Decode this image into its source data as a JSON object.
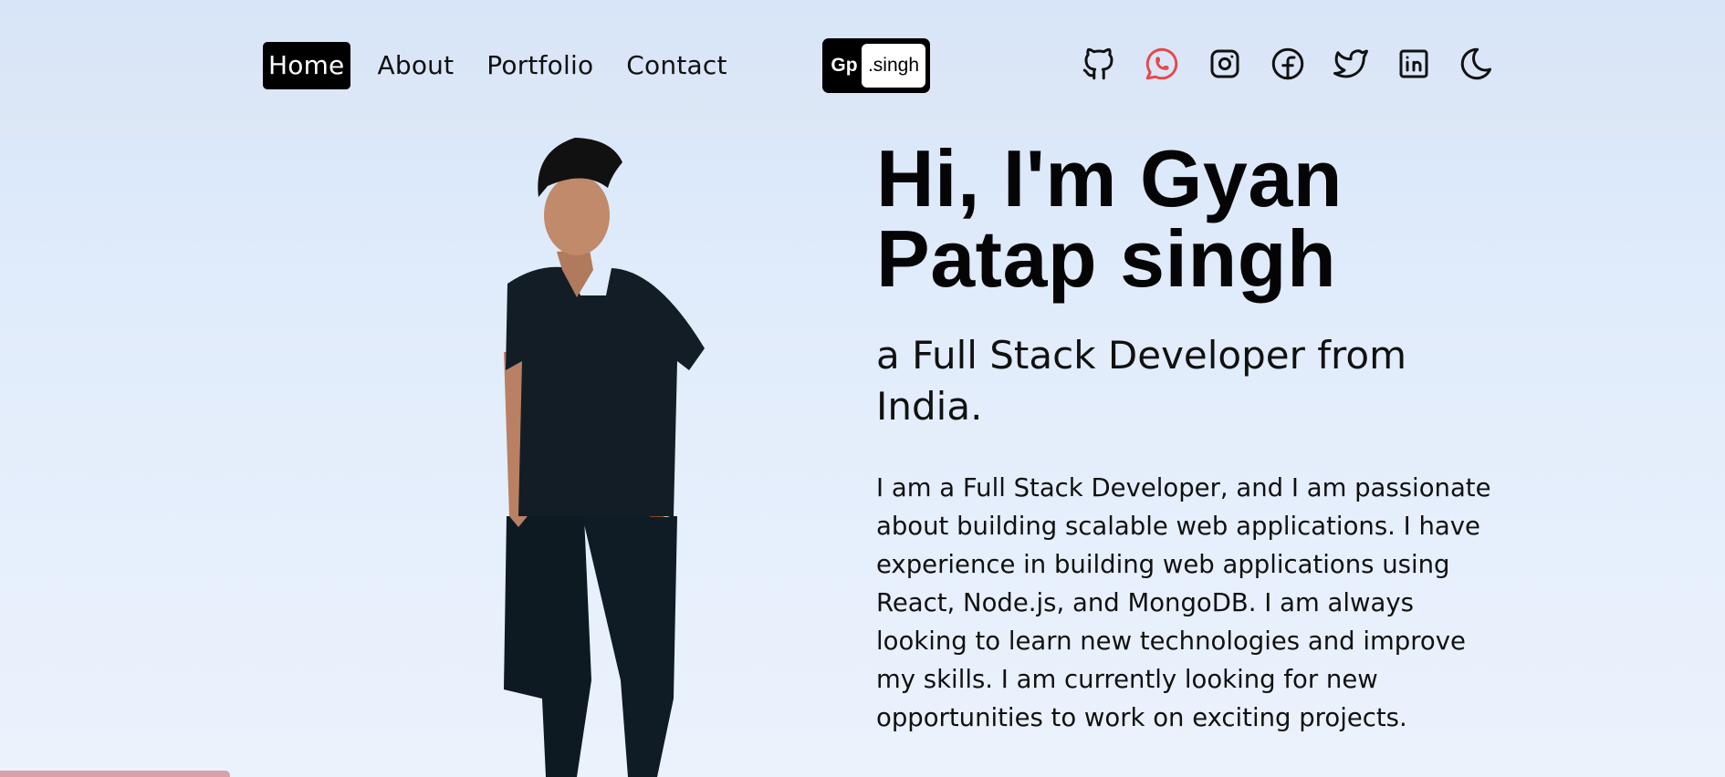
{
  "nav": {
    "links": [
      {
        "label": "Home",
        "active": true
      },
      {
        "label": "About",
        "active": false
      },
      {
        "label": "Portfolio",
        "active": false
      },
      {
        "label": "Contact",
        "active": false
      }
    ]
  },
  "logo": {
    "prefix": "Gp",
    "name": ".singh"
  },
  "social": {
    "icons": [
      "github-icon",
      "whatsapp-icon",
      "instagram-icon",
      "facebook-icon",
      "twitter-icon",
      "linkedin-icon",
      "moon-icon"
    ],
    "whatsapp_color": "#e5484d"
  },
  "hero": {
    "title_line1": "Hi, I'm Gyan",
    "title_line2": "Patap singh",
    "subtitle": "a Full Stack Developer from India.",
    "bio": "I am a Full Stack Developer, and I am passionate about building scalable web applications. I have experience in building web applications using React, Node.js, and MongoDB. I am always looking to learn new technologies and improve my skills. I am currently looking for new opportunities to work on exciting projects."
  },
  "colors": {
    "background": "#dfeafa",
    "accent": "#000000",
    "bottom_bar": "#d9a0aa"
  }
}
